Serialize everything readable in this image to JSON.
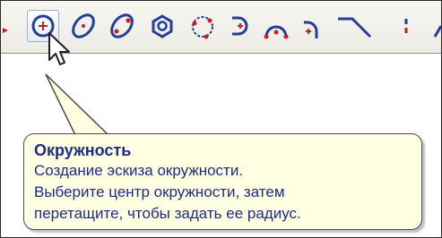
{
  "toolbar": {
    "tools": [
      {
        "icon": "dropdown-arrow-icon"
      },
      {
        "icon": "circle-center-icon",
        "pressed": true
      },
      {
        "icon": "ellipse-icon"
      },
      {
        "icon": "ellipse-axes-icon"
      },
      {
        "icon": "polygon-icon"
      },
      {
        "icon": "circle-three-points-icon"
      },
      {
        "icon": "arc-tangent-icon"
      },
      {
        "icon": "arc-three-points-icon"
      },
      {
        "icon": "arc-center-icon"
      },
      {
        "icon": "line-icon"
      },
      {
        "icon": "separator"
      }
    ],
    "accent_color": "#1f2a8a",
    "icon_red": "#c81e1e",
    "icon_blue": "#233f9a"
  },
  "tooltip": {
    "title": "Окружность",
    "lines": [
      "Создание эскиза окружности.",
      "Выберите центр окружности, затем",
      "перетащите, чтобы задать ее радиус."
    ],
    "background": "#ffffe1"
  }
}
